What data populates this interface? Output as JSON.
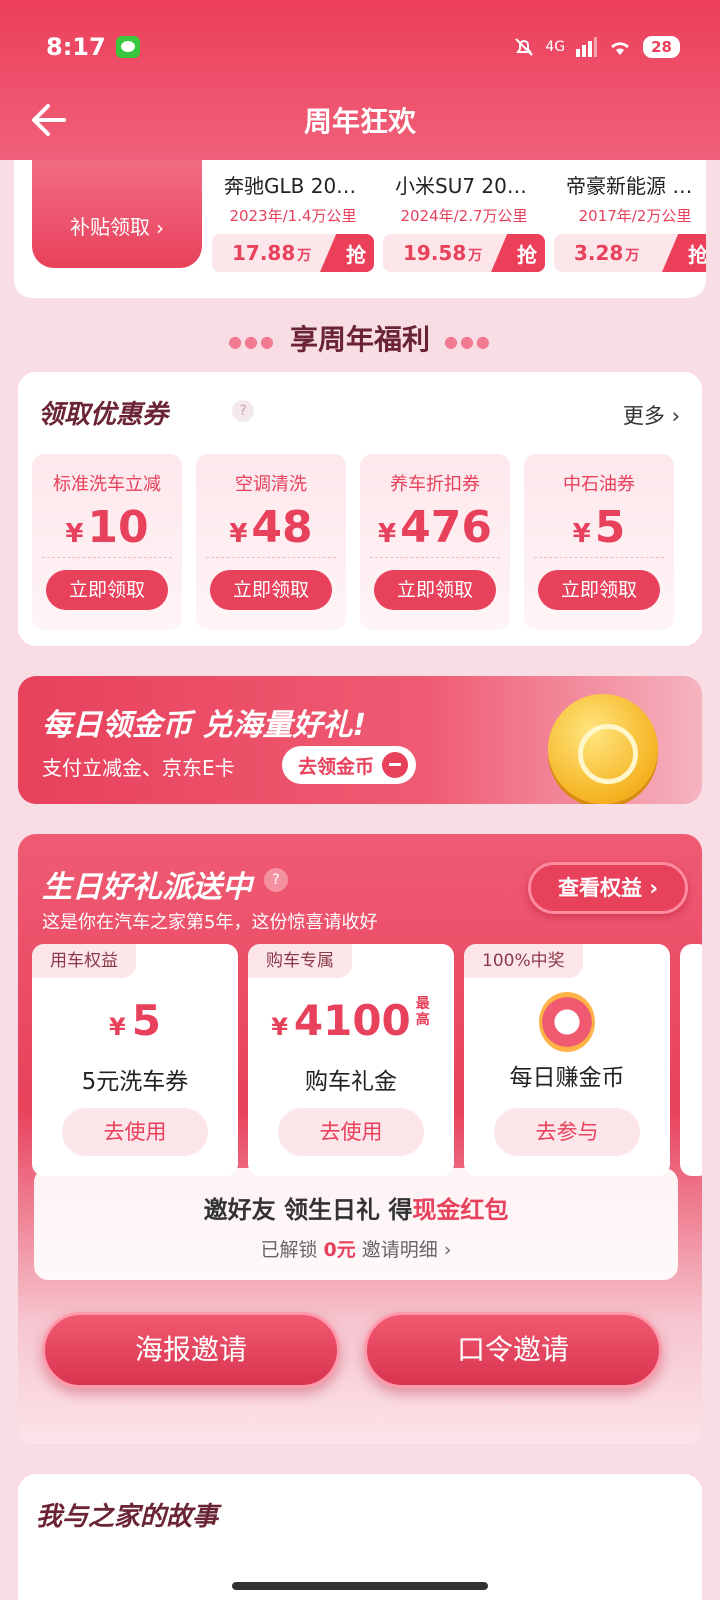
{
  "status": {
    "time": "8:17",
    "network": "4G",
    "battery": "28"
  },
  "header": {
    "title": "周年狂欢"
  },
  "cars": {
    "subsidy_label": "补贴领取",
    "items": [
      {
        "name": "奔驰GLB 20…",
        "meta": "2023年/1.4万公里",
        "price": "17.88",
        "unit": "万",
        "grab": "抢"
      },
      {
        "name": "小米SU7 20…",
        "meta": "2024年/2.7万公里",
        "price": "19.58",
        "unit": "万",
        "grab": "抢"
      },
      {
        "name": "帝豪新能源 …",
        "meta": "2017年/2万公里",
        "price": "3.28",
        "unit": "万",
        "grab": "抢"
      }
    ]
  },
  "welfare": {
    "title": "享周年福利"
  },
  "coupons": {
    "title": "领取优惠券",
    "help": "?",
    "more": "更多",
    "items": [
      {
        "name": "标准洗车立减",
        "currency": "¥",
        "amount": "10",
        "button": "立即领取"
      },
      {
        "name": "空调清洗",
        "currency": "¥",
        "amount": "48",
        "button": "立即领取"
      },
      {
        "name": "养车折扣券",
        "currency": "¥",
        "amount": "476",
        "button": "立即领取"
      },
      {
        "name": "中石油券",
        "currency": "¥",
        "amount": "5",
        "button": "立即领取"
      }
    ]
  },
  "gold": {
    "title": "每日领金币 兑海量好礼!",
    "subtitle": "支付立减金、京东E卡",
    "button": "去领金币"
  },
  "birthday": {
    "title": "生日好礼派送中",
    "help": "?",
    "subtitle": "这是你在汽车之家第5年，这份惊喜请收好",
    "rights_button": "查看权益",
    "cards": [
      {
        "tag": "用车权益",
        "currency": "¥",
        "amount": "5",
        "name": "5元洗车券",
        "button": "去使用"
      },
      {
        "tag": "购车专属",
        "currency": "¥",
        "amount": "4100",
        "note": "最高",
        "name": "购车礼金",
        "button": "去使用"
      },
      {
        "tag": "100%中奖",
        "name": "每日赚金币",
        "button": "去参与"
      }
    ],
    "invite": {
      "line_a": "邀好友 领生日礼 得",
      "line_b": "现金红包",
      "unlocked": "已解锁",
      "cash": "0元",
      "detail": "邀请明细"
    },
    "poster_button": "海报邀请",
    "code_button": "口令邀请"
  },
  "story": {
    "title": "我与之家的故事"
  },
  "colors": {
    "brand": "#e8415c",
    "header": "#ec3f5a",
    "page_bg": "#f9dde4"
  }
}
